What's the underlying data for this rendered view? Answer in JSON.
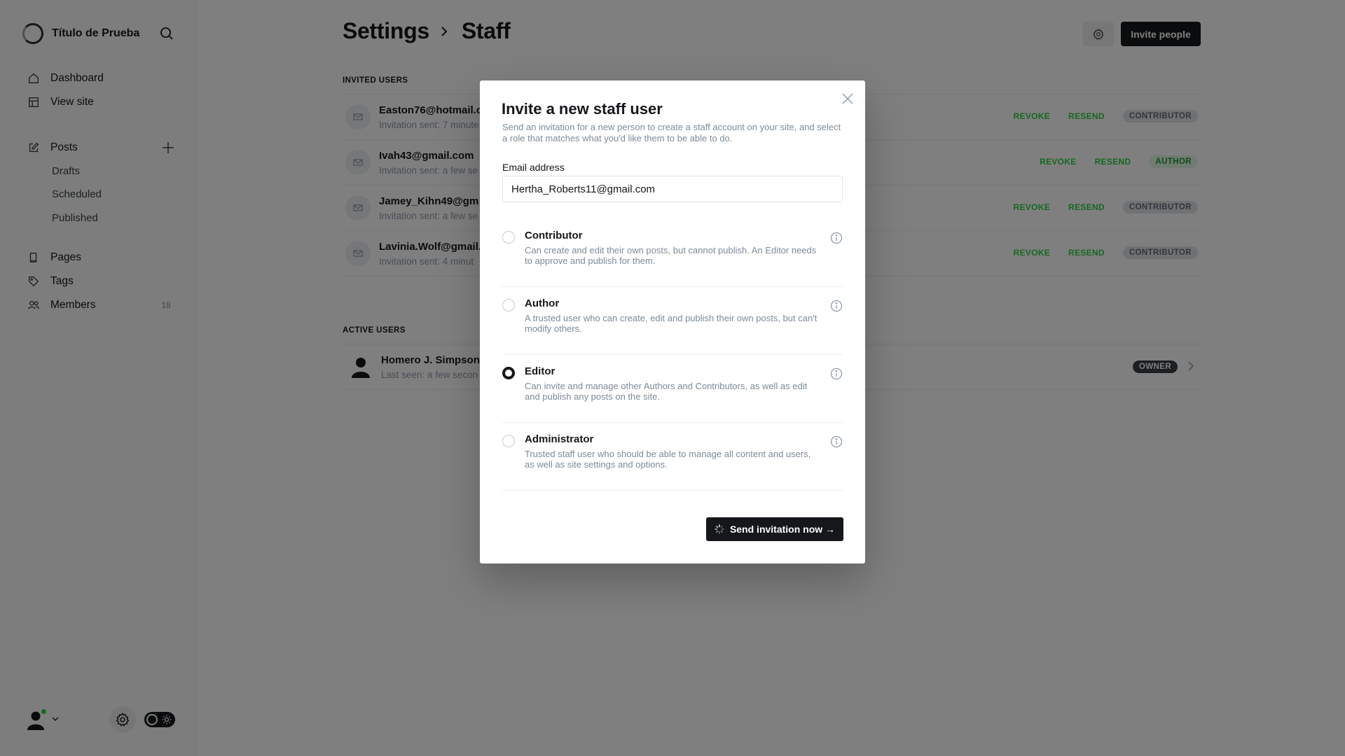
{
  "sidebar": {
    "site_title": "Título de Prueba",
    "nav": {
      "dashboard": "Dashboard",
      "view_site": "View site",
      "posts": "Posts",
      "drafts": "Drafts",
      "scheduled": "Scheduled",
      "published": "Published",
      "pages": "Pages",
      "tags": "Tags",
      "members": "Members",
      "members_count": "18"
    }
  },
  "header": {
    "breadcrumb": [
      "Settings",
      "Staff"
    ],
    "invite_button": "Invite people"
  },
  "invited": {
    "label": "INVITED USERS",
    "revoke_label": "REVOKE",
    "resend_label": "RESEND",
    "users": [
      {
        "email": "Easton76@hotmail.c",
        "sent": "Invitation sent: 7 minute",
        "role": "CONTRIBUTOR"
      },
      {
        "email": "Ivah43@gmail.com",
        "sent": "Invitation sent: a few se",
        "role": "AUTHOR"
      },
      {
        "email": "Jamey_Kihn49@gm",
        "sent": "Invitation sent: a few se",
        "role": "CONTRIBUTOR"
      },
      {
        "email": "Lavinia.Wolf@gmail.",
        "sent": "Invitation sent: 4 minut",
        "role": "CONTRIBUTOR"
      }
    ]
  },
  "active": {
    "label": "ACTIVE USERS",
    "users": [
      {
        "name": "Homero J. Simpson",
        "seen": "Last seen: a few secon",
        "role": "OWNER"
      }
    ]
  },
  "modal": {
    "title": "Invite a new staff user",
    "description": "Send an invitation for a new person to create a staff account on your site, and select a role that matches what you'd like them to be able to do.",
    "email_label": "Email address",
    "email_value": "Hertha_Roberts11@gmail.com",
    "selected_role": "Editor",
    "roles": [
      {
        "name": "Contributor",
        "desc": "Can create and edit their own posts, but cannot publish. An Editor needs to approve and publish for them."
      },
      {
        "name": "Author",
        "desc": "A trusted user who can create, edit and publish their own posts, but can't modify others."
      },
      {
        "name": "Editor",
        "desc": "Can invite and manage other Authors and Contributors, as well as edit and publish any posts on the site."
      },
      {
        "name": "Administrator",
        "desc": "Trusted staff user who should be able to manage all content and users, as well as site settings and options."
      }
    ],
    "send_button": "Send invitation now →"
  },
  "colors": {
    "accent_green": "#30cf43",
    "dark": "#15171a",
    "overlay": "rgba(0,0,0,0.5)"
  }
}
